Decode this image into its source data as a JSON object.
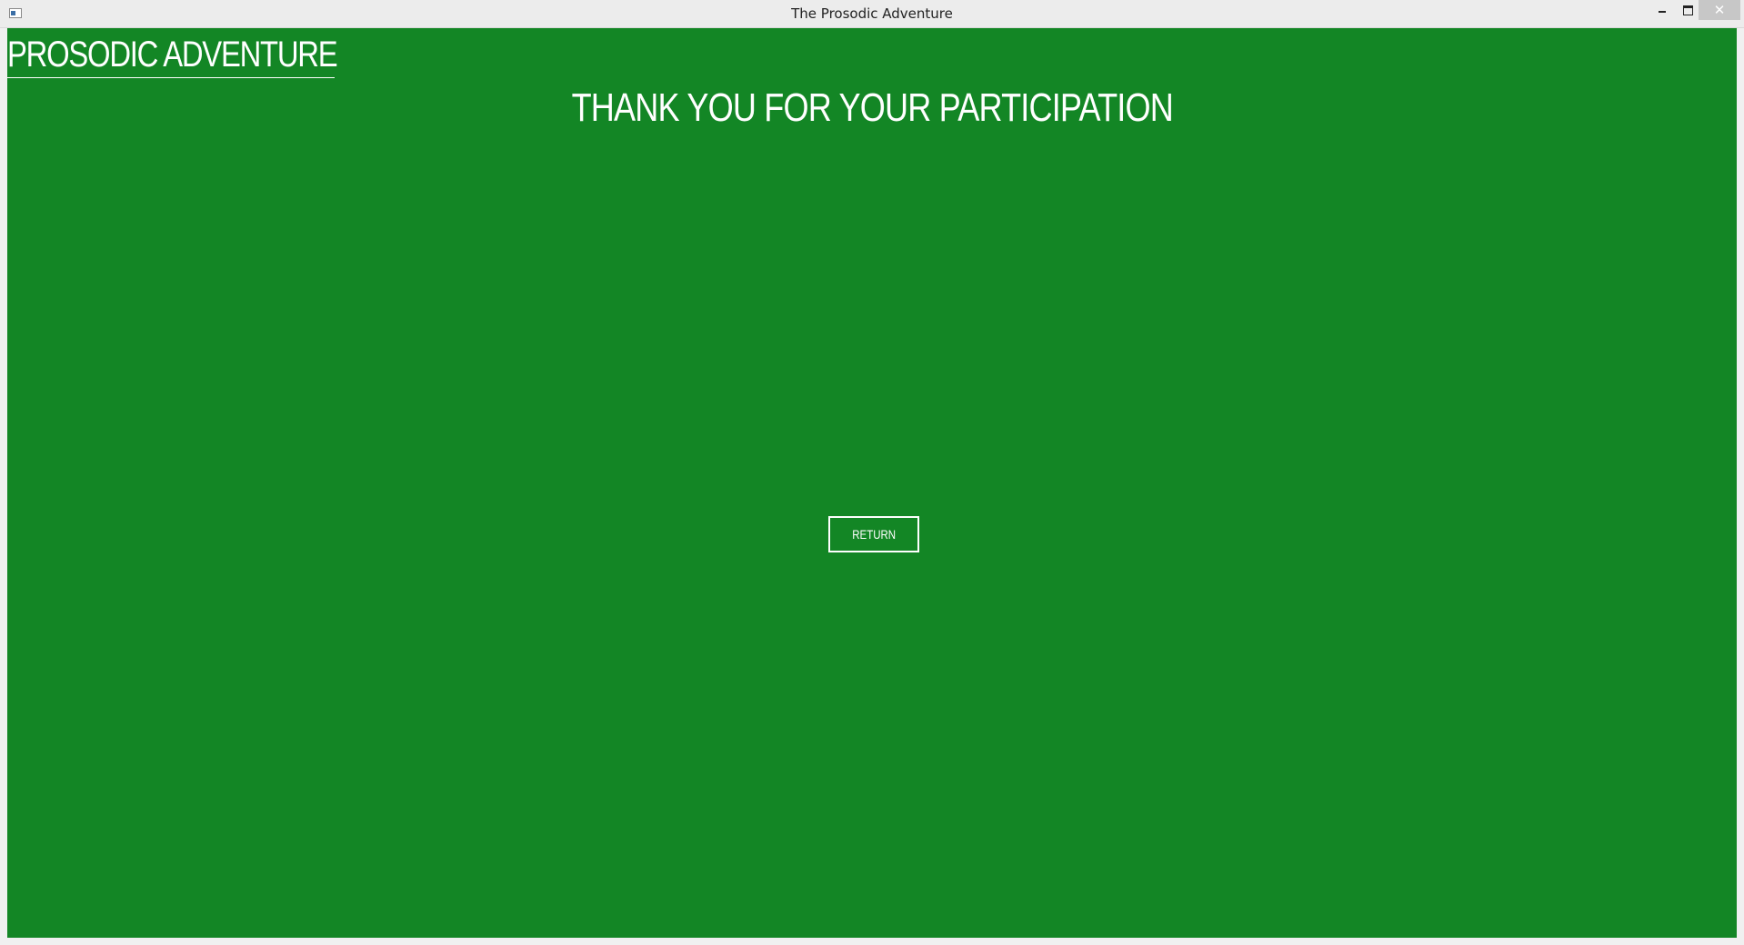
{
  "window": {
    "title": "The Prosodic Adventure",
    "controls": {
      "minimize": "–",
      "maximize": "□",
      "close": "✕"
    }
  },
  "app": {
    "heading": "PROSODIC ADVENTURE",
    "message": "THANK YOU FOR YOUR PARTICIPATION",
    "return_label": "RETURN"
  },
  "colors": {
    "background": "#138625",
    "foreground": "#ffffff"
  }
}
